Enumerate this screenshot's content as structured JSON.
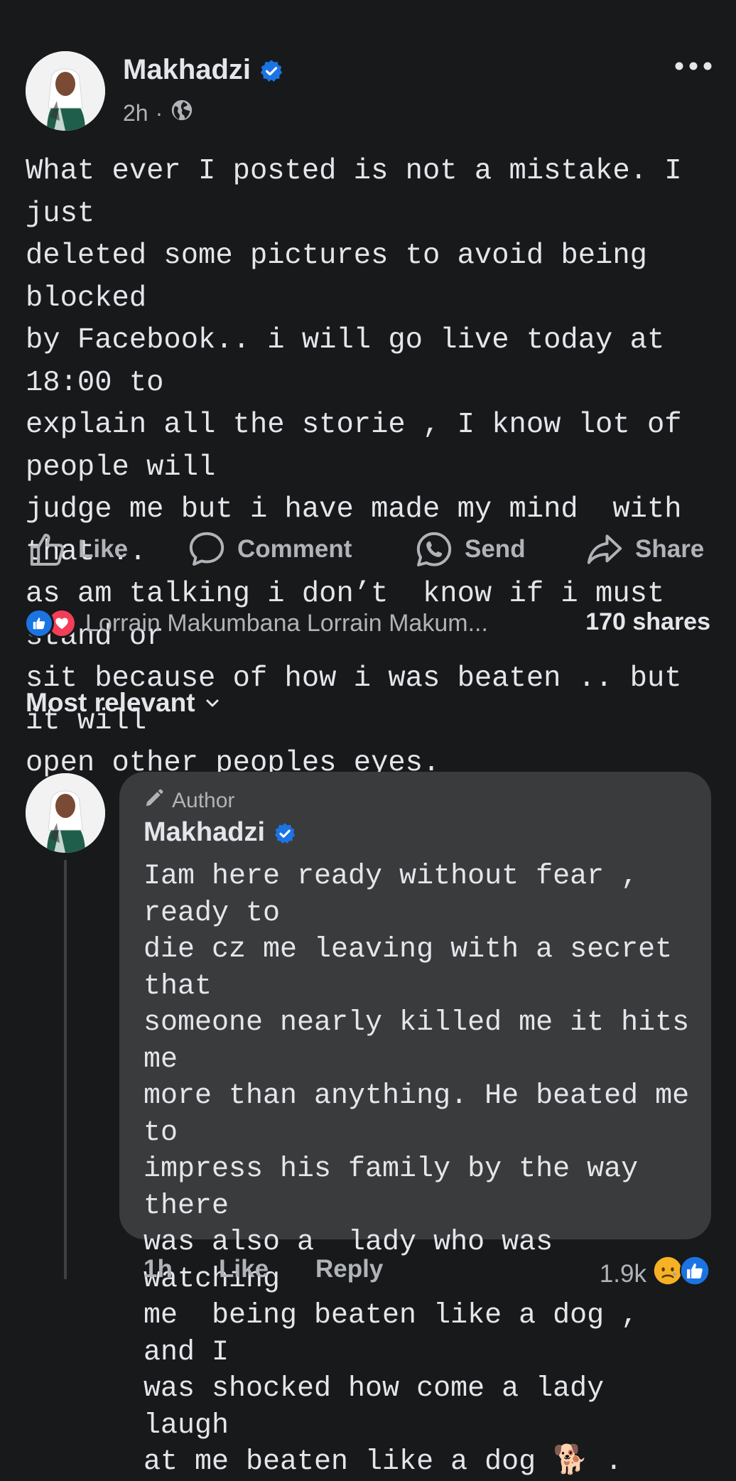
{
  "post": {
    "author": "Makhadzi",
    "time": "2h",
    "audience_icon": "globe-icon",
    "more_icon": "more-dots-icon",
    "body": "What ever I posted is not a mistake. I just\ndeleted some pictures to avoid being blocked\nby Facebook.. i will go live today at 18:00 to\nexplain all the storie , I know lot of people will\njudge me but i have made my mind  with that ..\nas am talking i don’t  know if i must  stand or\nsit because of how i was beaten .. but it will\nopen other peoples eyes."
  },
  "actions": {
    "like": "Like",
    "comment": "Comment",
    "send": "Send",
    "share": "Share"
  },
  "reactions": {
    "names": "Lorrain Makumbana Lorrain Makum...",
    "shares": "170 shares",
    "icons": [
      "like-reaction-icon",
      "love-reaction-icon"
    ]
  },
  "sort": {
    "label": "Most relevant"
  },
  "comment": {
    "badge": "Author",
    "author": "Makhadzi",
    "text": "Iam here ready without fear , ready to\ndie cz me leaving with a secret that\nsomeone nearly killed me it hits me\nmore than anything. He beated me to\nimpress his family by the way there\nwas also a  lady who was watching\nme  being beaten like a dog , and I\nwas shocked how come a lady laugh\nat me beaten like a dog 🐕 .",
    "time": "1h",
    "like": "Like",
    "reply": "Reply",
    "reaction_count": "1.9k",
    "reaction_icons": [
      "sad-reaction-icon",
      "like-reaction-icon"
    ]
  },
  "colors": {
    "background": "#18191a",
    "bubble": "#3a3b3c",
    "primary_text": "#e4e6eb",
    "secondary_text": "#b0b3b8",
    "verified_blue": "#1b74e4",
    "love_red": "#f33e58"
  }
}
